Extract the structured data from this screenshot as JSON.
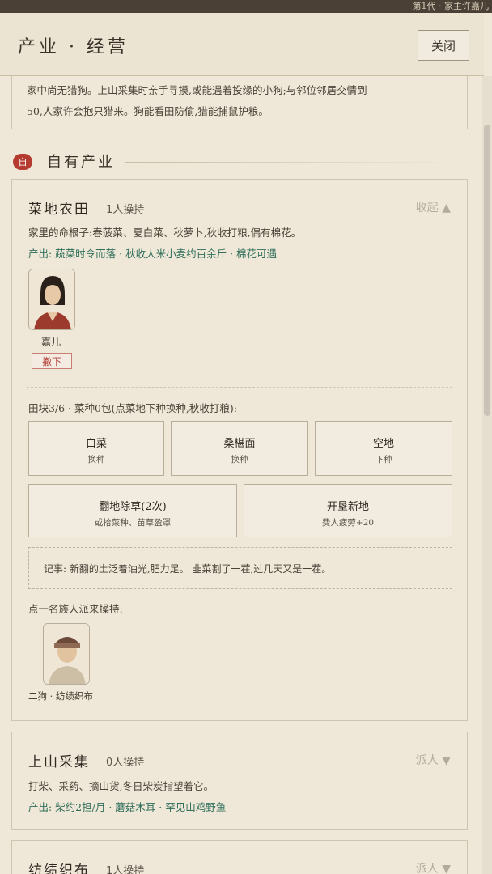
{
  "top_strip": "第1代 · 家主许嘉儿",
  "header": {
    "title": "产业 · 经营",
    "close_label": "关闭"
  },
  "intro": {
    "line1": "家中尚无猎狗。上山采集时亲手寻摸,或能遇着投缘的小狗;与邻位邻居交情到",
    "line2": "50,人家许会抱只猎来。狗能看田防偷,猎能捕鼠护粮。"
  },
  "section": {
    "badge": "自",
    "title": "自有产业"
  },
  "industries": [
    {
      "title": "菜地农田",
      "count": "1人操持",
      "toggle": "收起 ▲",
      "desc": "家里的命根子:春菠菜、夏白菜、秋萝卜,秋收打粮,偶有棉花。",
      "output": "产出: 蔬菜时令而落 · 秋收大米小麦约百余斤 · 棉花可遇",
      "worker": {
        "name": "嘉儿",
        "revoke": "撤下"
      },
      "plots_info": "田块3/6 · 菜种0包(点菜地下种换种,秋收打粮):",
      "plots": [
        {
          "title": "白菜",
          "sub": "换种"
        },
        {
          "title": "桑椹面",
          "sub": "换种"
        },
        {
          "title": "空地",
          "sub": "下种"
        }
      ],
      "actions": [
        {
          "title": "翻地除草(2次)",
          "sub": "或拾菜种、苗草盈罩"
        },
        {
          "title": "开垦新地",
          "sub": "费人疲劳+20"
        }
      ],
      "note": "记事: 新翻的土泛着油光,肥力足。 韭菜割了一茬,过几天又是一茬。",
      "assign_prompt": "点一名族人派来操持:",
      "candidate": {
        "label": "二狗 · 纺绩织布"
      }
    },
    {
      "title": "上山采集",
      "count": "0人操持",
      "toggle": "派人 ▼",
      "desc": "打柴、采药、摘山货,冬日柴炭指望着它。",
      "output": "产出: 柴约2担/月 · 蘑菇木耳 · 罕见山鸡野鱼"
    },
    {
      "title": "纺绩织布",
      "count": "1人操持",
      "toggle": "派人 ▼"
    }
  ],
  "colors": {
    "accent_red": "#b53b31",
    "output_green": "#2f6e5a",
    "bg": "#efe8d8"
  }
}
